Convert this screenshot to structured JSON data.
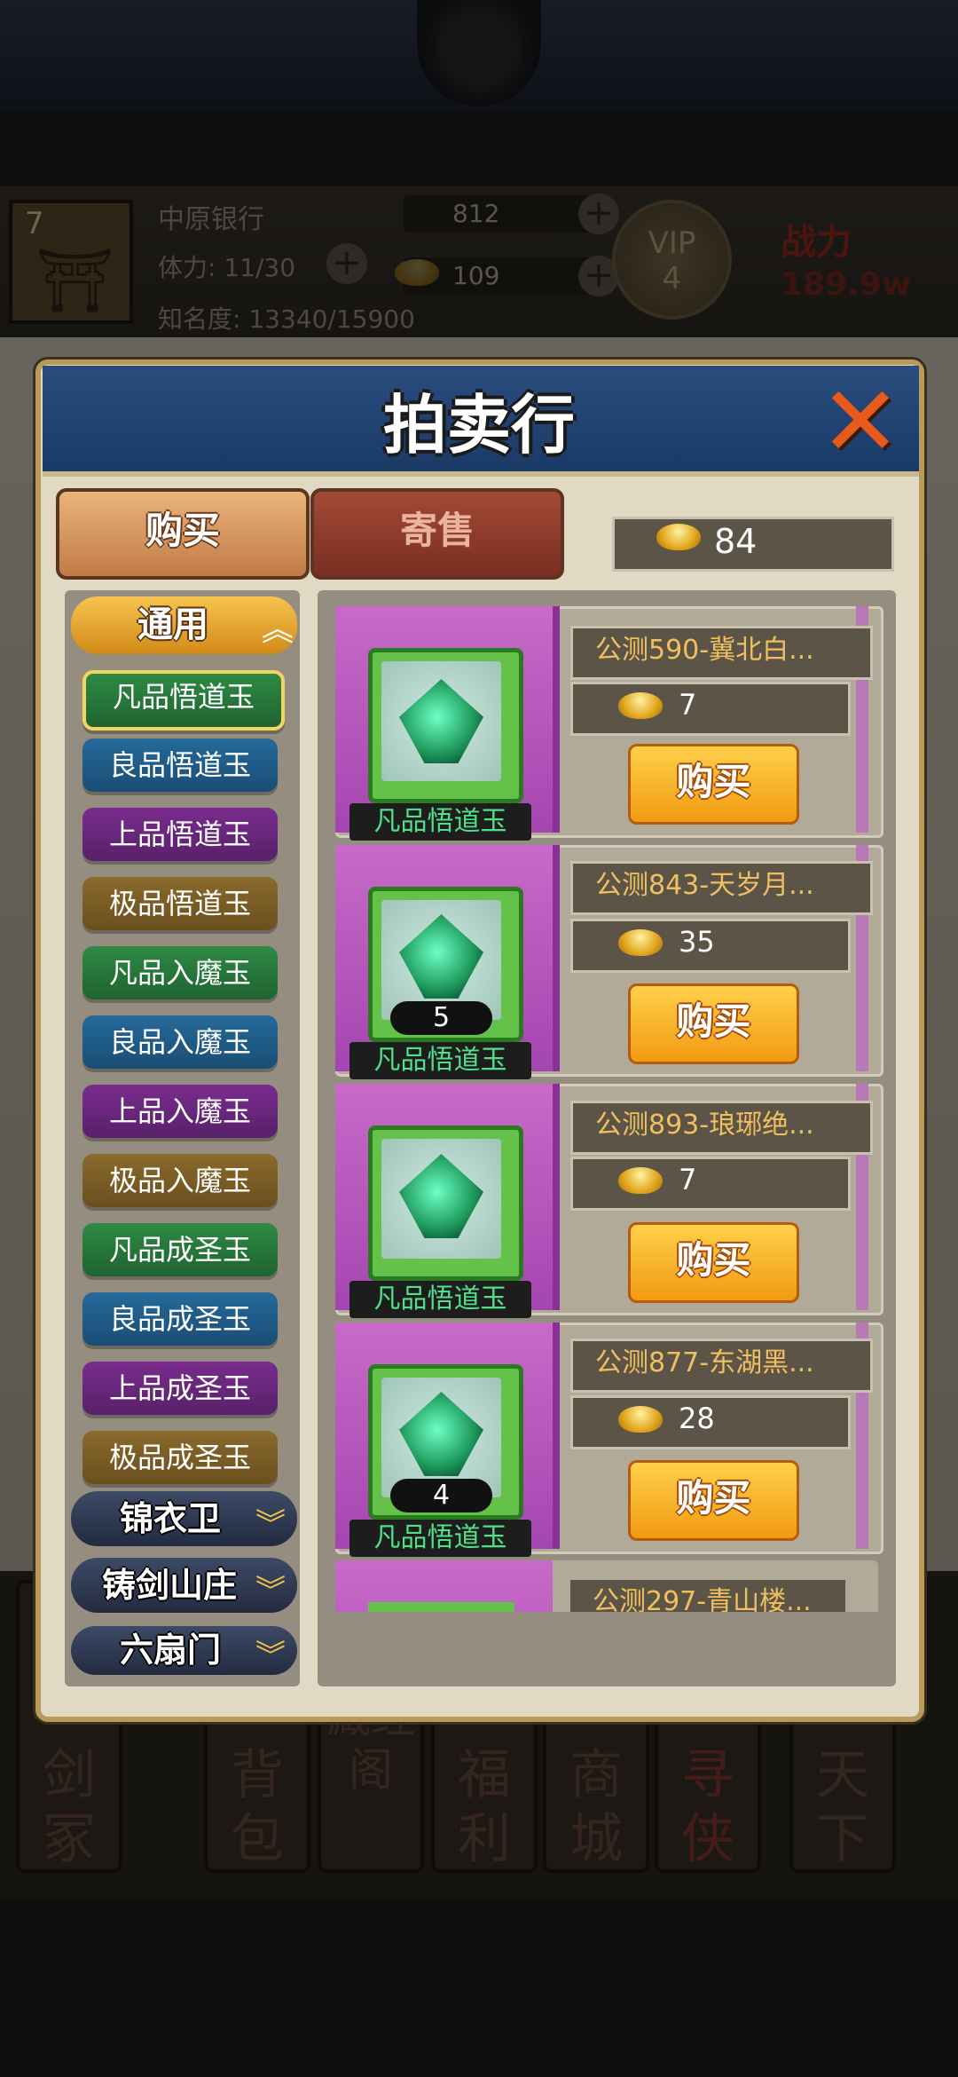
{
  "player": {
    "level": "7",
    "name": "中原银行",
    "stamina": "体力: 11/30",
    "fame": "知名度: 13340/15900",
    "silver": "812",
    "gold": "109",
    "vip_label": "VIP",
    "vip_level": "4",
    "power_label": "战力",
    "power_value": "189.9w"
  },
  "background_nav": [
    "剑冢",
    "背包",
    "藏经阁",
    "福利",
    "商城",
    "寻侠",
    "天下"
  ],
  "dialog": {
    "title": "拍卖行",
    "tabs": {
      "buy": "购买",
      "sell": "寄售"
    },
    "balance": "84"
  },
  "categories": {
    "general_label": "通用",
    "items": [
      {
        "label": "凡品悟道玉",
        "tier": "green"
      },
      {
        "label": "良品悟道玉",
        "tier": "blue"
      },
      {
        "label": "上品悟道玉",
        "tier": "purple"
      },
      {
        "label": "极品悟道玉",
        "tier": "gold"
      },
      {
        "label": "凡品入魔玉",
        "tier": "green"
      },
      {
        "label": "良品入魔玉",
        "tier": "blue"
      },
      {
        "label": "上品入魔玉",
        "tier": "purple"
      },
      {
        "label": "极品入魔玉",
        "tier": "gold"
      },
      {
        "label": "凡品成圣玉",
        "tier": "green"
      },
      {
        "label": "良品成圣玉",
        "tier": "blue"
      },
      {
        "label": "上品成圣玉",
        "tier": "purple"
      },
      {
        "label": "极品成圣玉",
        "tier": "gold"
      }
    ],
    "selected": "凡品悟道玉",
    "factions": [
      "锦衣卫",
      "铸剑山庄",
      "六扇门"
    ]
  },
  "listings": [
    {
      "item": "凡品悟道玉",
      "quantity": "",
      "seller": "公测590-冀北白...",
      "price": "7",
      "buy": "购买"
    },
    {
      "item": "凡品悟道玉",
      "quantity": "5",
      "seller": "公测843-天岁月...",
      "price": "35",
      "buy": "购买"
    },
    {
      "item": "凡品悟道玉",
      "quantity": "",
      "seller": "公测893-琅琊绝...",
      "price": "7",
      "buy": "购买"
    },
    {
      "item": "凡品悟道玉",
      "quantity": "4",
      "seller": "公测877-东湖黑...",
      "price": "28",
      "buy": "购买"
    },
    {
      "item": "",
      "quantity": "",
      "seller": "公测297-青山楼...",
      "price": "",
      "buy": ""
    }
  ],
  "colors": {
    "header_blue": "#1a3a66",
    "buy_orange": "#f29a12",
    "item_name_green": "#4fe08a",
    "seller_gold": "#f0c060",
    "card_purple": "#a446b0"
  },
  "icons": [
    "close-icon",
    "gold-ingot-icon",
    "silver-ingot-icon",
    "jade-icon",
    "chevron-up-icon",
    "chevron-down-icon",
    "plus-icon",
    "pagoda-icon"
  ]
}
